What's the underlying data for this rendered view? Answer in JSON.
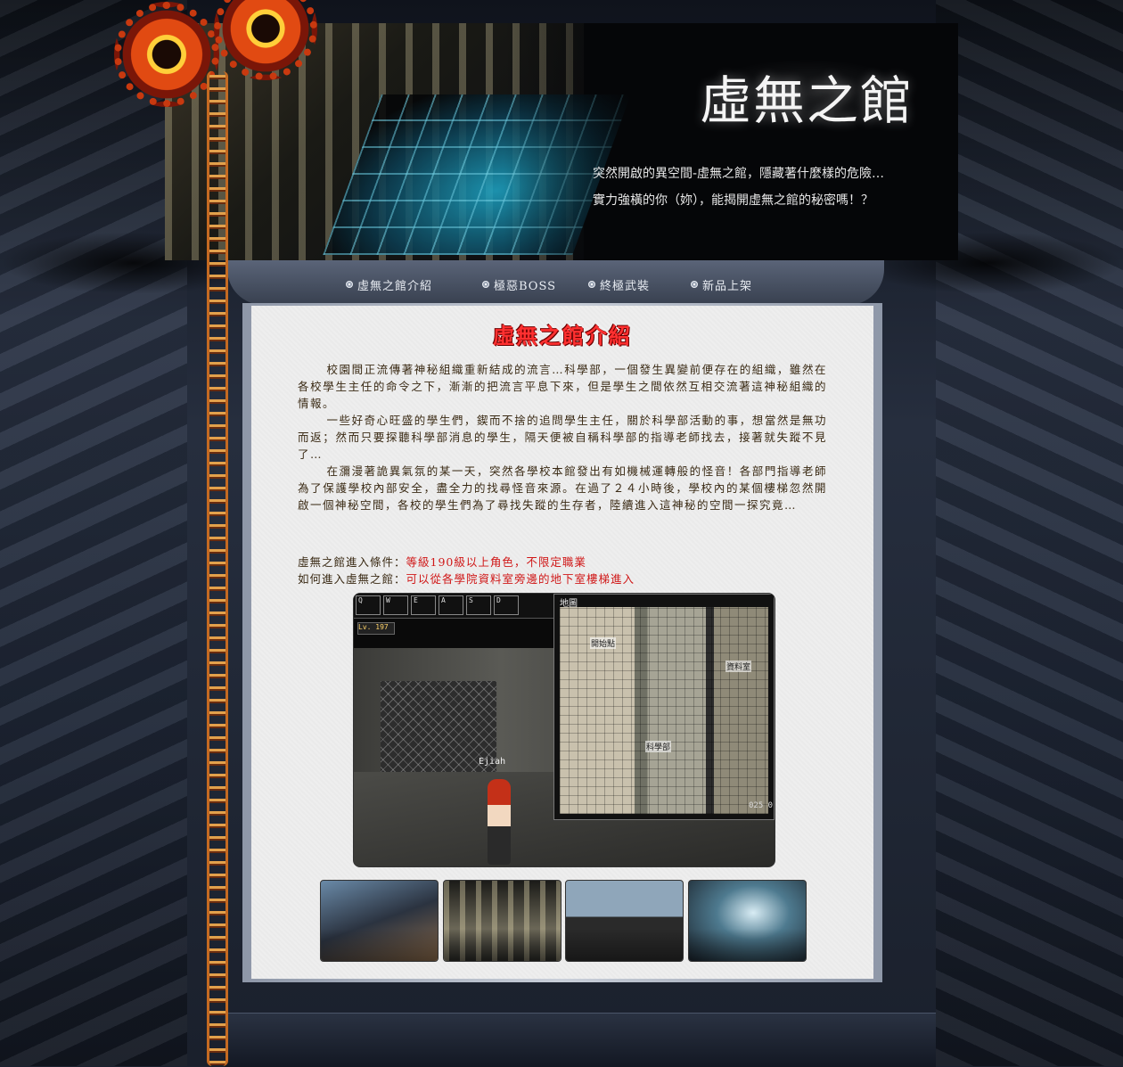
{
  "header": {
    "site_title": "虛無之館",
    "tagline_1": "突然開啟的異空間-虛無之館，隱藏著什麼樣的危險…",
    "tagline_2": "實力強橫的你（妳），能揭開虛無之館的秘密嗎！？"
  },
  "nav": {
    "items": [
      {
        "label": "虛無之館介紹"
      },
      {
        "label": "極惡BOSS"
      },
      {
        "label": "終極武裝"
      },
      {
        "label": "新品上架"
      }
    ]
  },
  "content": {
    "heading": "虛無之館介紹",
    "paragraphs": [
      "校園間正流傳著神秘組織重新結成的流言…科學部，一個發生異變前便存在的組織，雖然在各校學生主任的命令之下，漸漸的把流言平息下來，但是學生之間依然互相交流著這神秘組織的情報。",
      "一些好奇心旺盛的學生們，鍥而不捨的追問學生主任，關於科學部活動的事，想當然是無功而返；然而只要探聽科學部消息的學生，隔天便被自稱科學部的指導老師找去，接著就失蹤不見了…",
      "在瀰漫著詭異氣氛的某一天，突然各學校本館發出有如機械運轉般的怪音！各部門指導老師為了保護學校內部安全，盡全力的找尋怪音來源。在過了２４小時後，學校內的某個樓梯忽然開啟一個神秘空間，各校的學生們為了尋找失蹤的生存者，陸續進入這神秘的空間一探究竟…"
    ],
    "conditions": [
      {
        "label": "虛無之館進入條件：",
        "value": "等級190級以上角色，不限定職業"
      },
      {
        "label": "如何進入虛無之館：",
        "value": "可以從各學院資料室旁邊的地下室樓梯進入"
      }
    ]
  },
  "screenshot": {
    "hud_slots": [
      "Q",
      "W",
      "E",
      "A",
      "S",
      "D"
    ],
    "level": "Lv. 197",
    "character_name": "Ejiah",
    "map_title": "地圖",
    "map_labels": [
      "開始點",
      "資料室",
      "科學部"
    ],
    "map_code": "025 0"
  }
}
